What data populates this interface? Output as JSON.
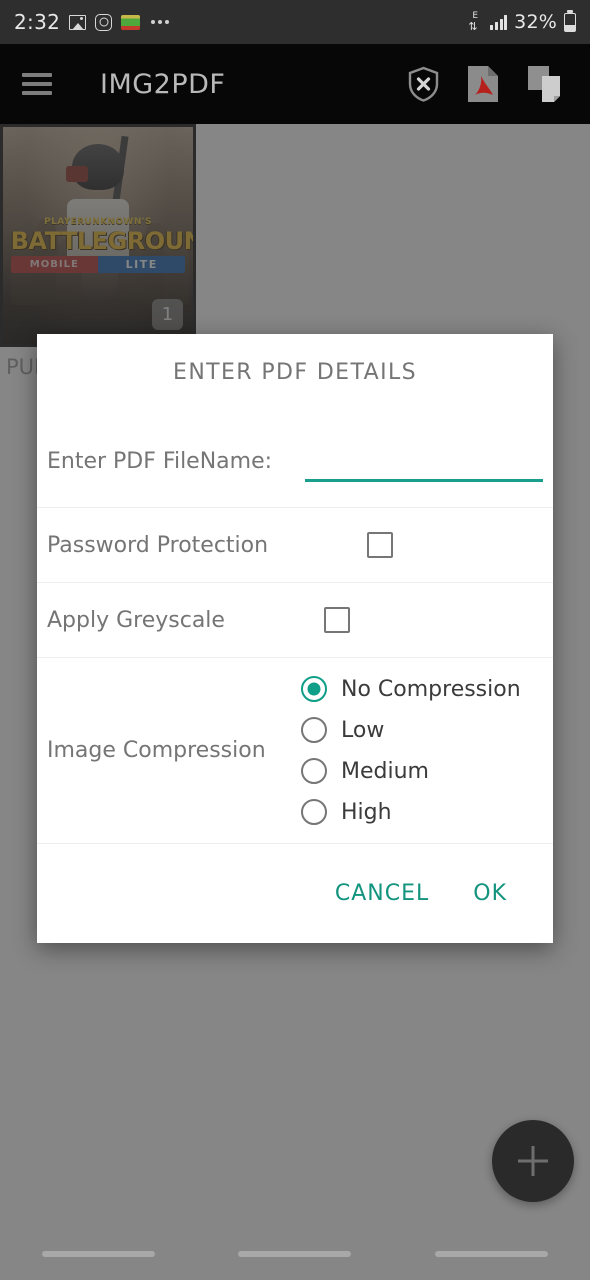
{
  "status_bar": {
    "time": "2:32",
    "battery_percent": "32%",
    "data_type": "E",
    "icons": [
      "gallery-icon",
      "instagram-icon",
      "color-app-icon",
      "more-icon",
      "edge-data-icon",
      "signal-icon",
      "battery-icon"
    ]
  },
  "app_bar": {
    "menu_icon": "hamburger-menu-icon",
    "title": "IMG2PDF",
    "actions": [
      {
        "name": "shield-x-icon",
        "label": "Remove Password"
      },
      {
        "name": "pdf-file-icon",
        "label": "View PDF"
      },
      {
        "name": "stacked-documents-icon",
        "label": "Merge PDF"
      }
    ]
  },
  "content": {
    "thumbnail": {
      "badge": "1",
      "caption": "PUBG MOBILE LITE",
      "logo_top": "PLAYERUNKNOWN'S",
      "logo_main": "BATTLEGROUNDS",
      "logo_mobile": "MOBILE",
      "logo_lite": "LITE"
    },
    "fab": {
      "name": "add-image-fab",
      "glyph": "+"
    }
  },
  "dialog": {
    "title": "ENTER PDF DETAILS",
    "filename": {
      "label": "Enter PDF FileName:",
      "value": "",
      "placeholder": ""
    },
    "password_protection": {
      "label": "Password Protection",
      "checked": false
    },
    "apply_greyscale": {
      "label": "Apply Greyscale",
      "checked": false
    },
    "image_compression": {
      "label": "Image Compression",
      "selected": "No Compression",
      "options": [
        {
          "label": "No Compression",
          "selected": true
        },
        {
          "label": "Low",
          "selected": false
        },
        {
          "label": "Medium",
          "selected": false
        },
        {
          "label": "High",
          "selected": false
        }
      ]
    },
    "actions": {
      "cancel": "CANCEL",
      "ok": "OK"
    }
  },
  "colors": {
    "accent_teal": "#12947f",
    "radio_teal": "#0f9e87",
    "underline_teal": "#179e8c",
    "app_bar": "#070707",
    "status_bar": "#2e2e2e",
    "scrim": "#6e6e6e"
  },
  "nav_bar": {
    "pills": [
      "recents-pill",
      "home-pill",
      "back-pill"
    ]
  }
}
